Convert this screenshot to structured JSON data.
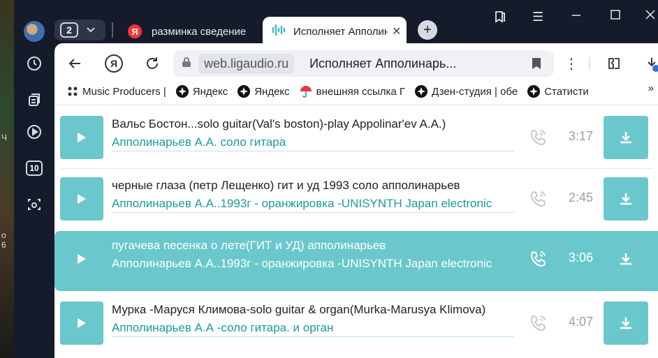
{
  "window": {
    "tab_count": "2",
    "tabs": [
      {
        "label": "разминка сведение"
      },
      {
        "label": "Исполняет Апполинарьев"
      }
    ]
  },
  "toolbar": {
    "domain": "web.ligaudio.ru",
    "page_title": "Исполняет Апполинарь..."
  },
  "bookmarks": [
    {
      "label": "Music Producers |",
      "icon": "music-producers-icon"
    },
    {
      "label": "Яндекс",
      "icon": "star-icon"
    },
    {
      "label": "Яндекс",
      "icon": "star-icon"
    },
    {
      "label": "внешняя ссылка Г",
      "icon": "umbrella-icon"
    },
    {
      "label": "Дзен-студия | обе",
      "icon": "star-icon"
    },
    {
      "label": "Статисти",
      "icon": "star-icon"
    }
  ],
  "bookmarks_more": "»",
  "sidebar": {
    "badge_10": "10"
  },
  "tracks": [
    {
      "title": "Вальс Бостон...solo guitar(Val's boston)-play Appolinar'ev A.A.)",
      "artist": "Апполинарьев А.А. соло гитара",
      "duration": "3:17",
      "active": false
    },
    {
      "title": "черные глаза (петр Лещенко) гит и уд 1993 соло апполинарьев",
      "artist": "Апполинарьев А.А..1993г - оранжировка -UNISYNTH Japan electronic",
      "duration": "2:45",
      "active": false
    },
    {
      "title": "пугачева песенка о лете(ГИТ и УД) апполинарьев",
      "artist": "Апполинарьев А.А..1993г - оранжировка -UNISYNTH Japan electronic",
      "duration": "3:06",
      "active": true
    },
    {
      "title": "Мурка -Маруся Климова-solo guitar & organ(Murka-Marusya Klimova)",
      "artist": "Апполинарьев А.А -соло гитара. и орган",
      "duration": "4:07",
      "active": false
    }
  ],
  "colors": {
    "accent": "#6ac8cc",
    "link": "#1c9a9e",
    "chrome": "#151b2b"
  }
}
